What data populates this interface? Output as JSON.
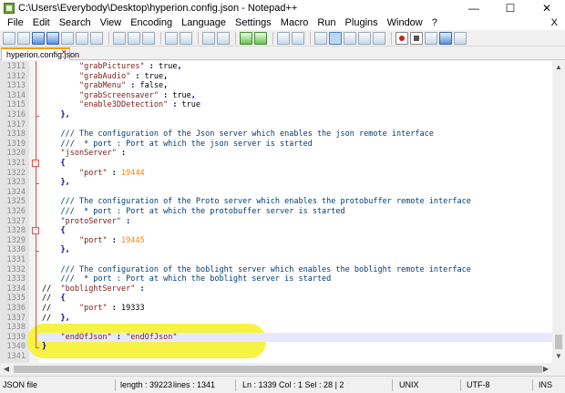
{
  "window": {
    "title": "C:\\Users\\Everybody\\Desktop\\hyperion.config.json - Notepad++",
    "minimize": "—",
    "maximize": "☐",
    "close": "✕"
  },
  "menu": {
    "items": [
      "File",
      "Edit",
      "Search",
      "View",
      "Encoding",
      "Language",
      "Settings",
      "Macro",
      "Run",
      "Plugins",
      "Window",
      "?"
    ],
    "close_glyph": "X"
  },
  "tab": {
    "label": "hyperion.config.json",
    "close_glyph": "✕"
  },
  "editor": {
    "lines": [
      {
        "n": "1311",
        "text": "        \"grabPictures\" : true,"
      },
      {
        "n": "1312",
        "text": "        \"grabAudio\" : true,"
      },
      {
        "n": "1313",
        "text": "        \"grabMenu\" : false,"
      },
      {
        "n": "1314",
        "text": "        \"grabScreensaver\" : true,"
      },
      {
        "n": "1315",
        "text": "        \"enable3DDetection\" : true"
      },
      {
        "n": "1316",
        "text": "    },"
      },
      {
        "n": "1317",
        "text": ""
      },
      {
        "n": "1318",
        "text": "    /// The configuration of the Json server which enables the json remote interface"
      },
      {
        "n": "1319",
        "text": "    ///  * port : Port at which the json server is started"
      },
      {
        "n": "1320",
        "text": "    \"jsonServer\" :"
      },
      {
        "n": "1321",
        "text": "    {"
      },
      {
        "n": "1322",
        "text": "        \"port\" : 19444"
      },
      {
        "n": "1323",
        "text": "    },"
      },
      {
        "n": "1324",
        "text": ""
      },
      {
        "n": "1325",
        "text": "    /// The configuration of the Proto server which enables the protobuffer remote interface"
      },
      {
        "n": "1326",
        "text": "    ///  * port : Port at which the protobuffer server is started"
      },
      {
        "n": "1327",
        "text": "    \"protoServer\" :"
      },
      {
        "n": "1328",
        "text": "    {"
      },
      {
        "n": "1329",
        "text": "        \"port\" : 19445"
      },
      {
        "n": "1330",
        "text": "    },"
      },
      {
        "n": "1331",
        "text": ""
      },
      {
        "n": "1332",
        "text": "    /// The configuration of the boblight server which enables the boblight remote interface"
      },
      {
        "n": "1333",
        "text": "    ///  * port : Port at which the boblight server is started"
      },
      {
        "n": "1334",
        "text": "//  \"boblightServer\" :"
      },
      {
        "n": "1335",
        "text": "//  {"
      },
      {
        "n": "1336",
        "text": "//      \"port\" : 19333"
      },
      {
        "n": "1337",
        "text": "//  },"
      },
      {
        "n": "1338",
        "text": ""
      },
      {
        "n": "1339",
        "text": "    \"endOfJson\" : \"endOfJson\""
      },
      {
        "n": "1340",
        "text": "}"
      },
      {
        "n": "1341",
        "text": ""
      }
    ]
  },
  "status": {
    "file_type": "JSON file",
    "length": "length : 39223",
    "lines": "lines : 1341",
    "position": "Ln : 1339    Col : 1    Sel : 28 | 2",
    "eol": "UNIX",
    "encoding": "UTF-8",
    "mode": "INS"
  },
  "colors": {
    "string": "#7d1a1a",
    "number": "#ff8000",
    "comment": "#003c7a",
    "highlight": "#f6f23a",
    "tab_accent": "#f0a000"
  }
}
